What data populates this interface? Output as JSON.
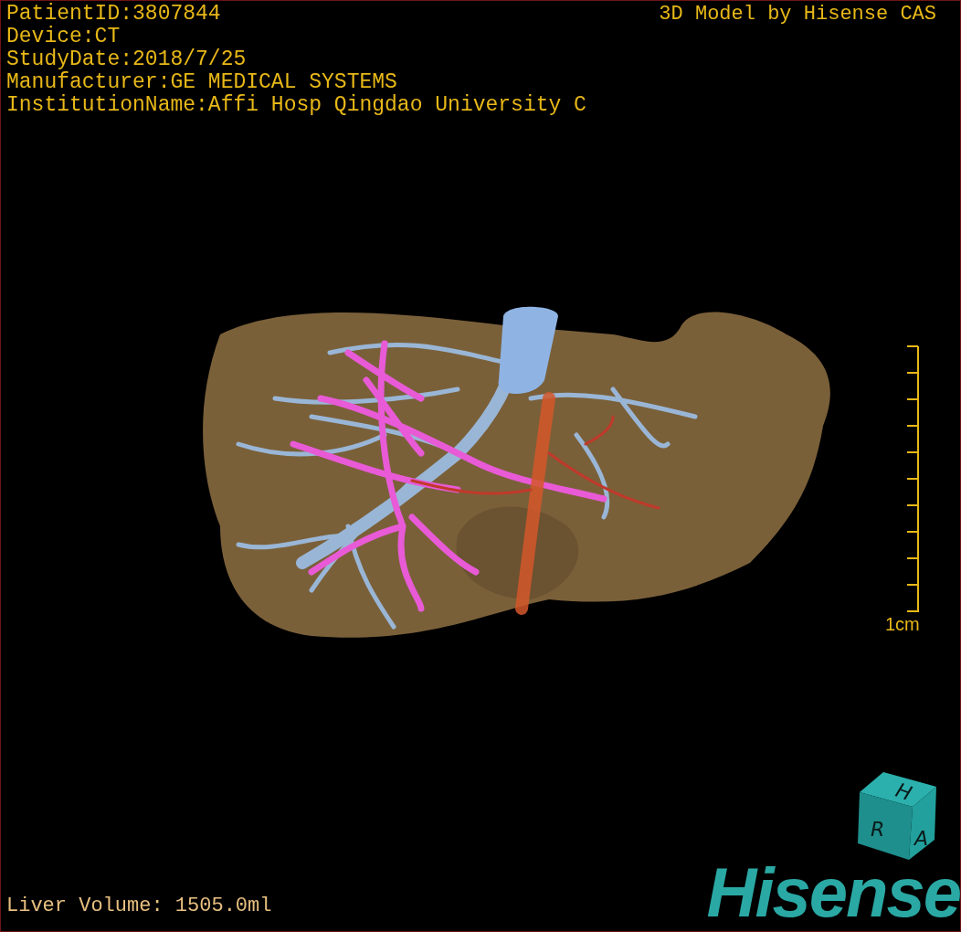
{
  "patient_info": [
    "PatientID:3807844",
    "Device:CT",
    "StudyDate:2018/7/25",
    "Manufacturer:GE MEDICAL SYSTEMS",
    "InstitutionName:Affi Hosp Qingdao University C"
  ],
  "model_credit": "3D Model by Hisense CAS",
  "scale_bar": {
    "label": "1cm"
  },
  "orientation_cube": {
    "top": "H",
    "left": "R",
    "right": "A"
  },
  "logo": "Hisense",
  "liver_volume": "Liver Volume: 1505.0ml"
}
